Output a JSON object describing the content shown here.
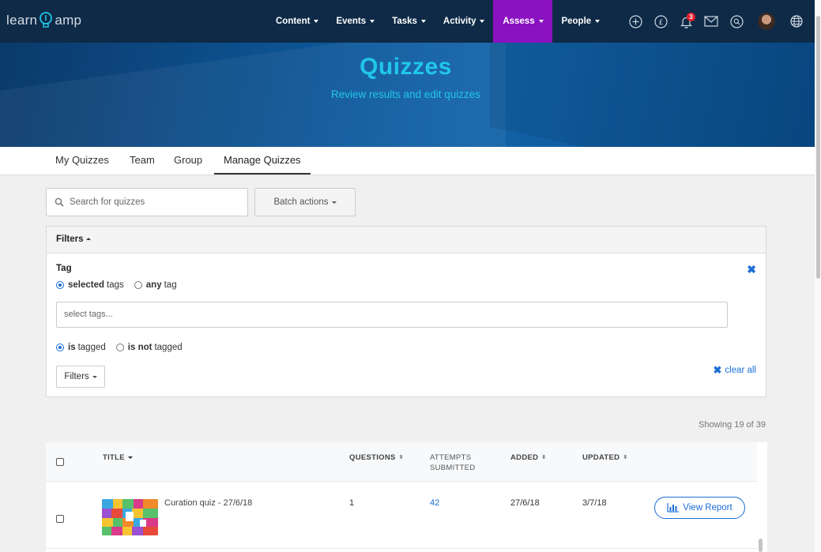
{
  "nav": {
    "logo_left": "learn",
    "logo_right": "amp",
    "items": [
      {
        "label": "Content"
      },
      {
        "label": "Events"
      },
      {
        "label": "Tasks"
      },
      {
        "label": "Activity"
      },
      {
        "label": "Assess"
      },
      {
        "label": "People"
      }
    ],
    "icons": [
      "plus-circle-icon",
      "pound-icon",
      "bell-icon",
      "mail-icon",
      "search-icon",
      "avatar",
      "globe-icon"
    ],
    "notification_count": "3",
    "active_color": "#8a12c0"
  },
  "hero": {
    "title": "Quizzes",
    "subtitle": "Review results and edit quizzes"
  },
  "tabs": [
    {
      "label": "My Quizzes"
    },
    {
      "label": "Team"
    },
    {
      "label": "Group"
    },
    {
      "label": "Manage Quizzes"
    }
  ],
  "search": {
    "placeholder": "Search for quizzes"
  },
  "batch_actions": "Batch actions",
  "filters": {
    "header": "Filters",
    "tag_label": "Tag",
    "radio1": {
      "bold": "selected",
      "rest": "tags"
    },
    "radio2": {
      "bold": "any",
      "rest": "tag"
    },
    "tags_placeholder": "select tags...",
    "radio3": {
      "bold": "is",
      "rest": "tagged"
    },
    "radio4": {
      "bold": "is not",
      "rest": "tagged"
    },
    "filters_button": "Filters",
    "clear_all": "clear all"
  },
  "showing": "Showing 19 of 39",
  "table": {
    "headers": {
      "title": "TITLE",
      "questions": "QUESTIONS",
      "attempts1": "ATTEMPTS",
      "attempts2": "SUBMITTED",
      "added": "ADDED",
      "updated": "UPDATED"
    },
    "rows": [
      {
        "title": "Curation quiz - 27/6/18",
        "questions": "1",
        "attempts": "42",
        "added": "27/6/18",
        "updated": "3/7/18",
        "action": "View Report"
      }
    ]
  }
}
